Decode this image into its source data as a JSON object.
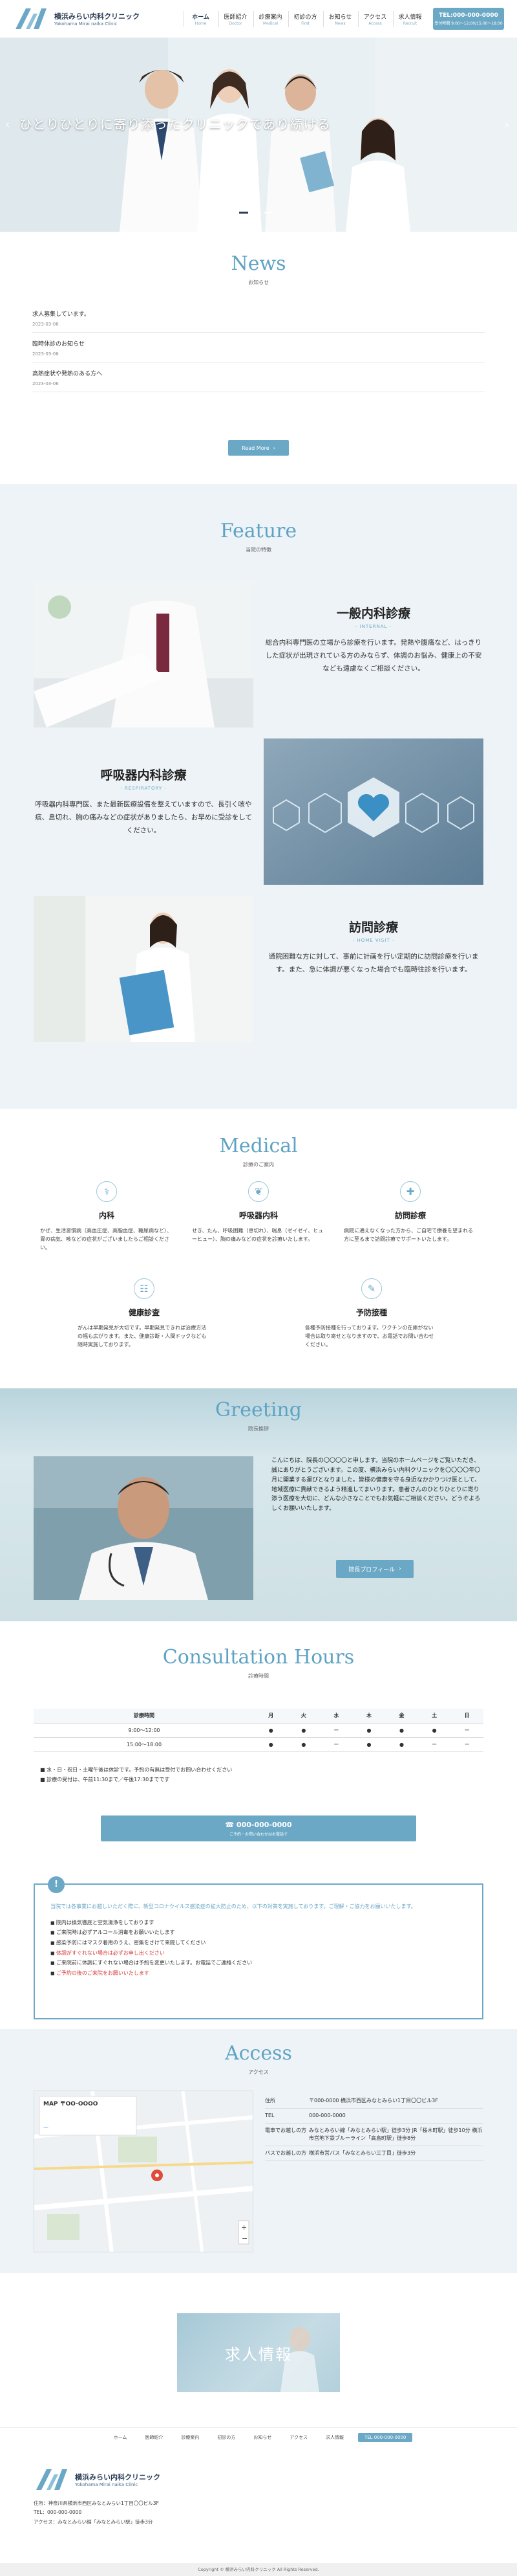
{
  "clinic": {
    "name_jp": "横浜みらい内科クリニック",
    "name_en": "Yokohama Mirai naika Clinic"
  },
  "nav": {
    "items": [
      {
        "jp": "ホーム",
        "en": "Home"
      },
      {
        "jp": "医師紹介",
        "en": "Doctor"
      },
      {
        "jp": "診療案内",
        "en": "Medical"
      },
      {
        "jp": "初診の方",
        "en": "First"
      },
      {
        "jp": "お知らせ",
        "en": "News"
      },
      {
        "jp": "アクセス",
        "en": "Access"
      },
      {
        "jp": "求人情報",
        "en": "Recruit"
      }
    ],
    "tel_number": "TEL:000-000-0000",
    "tel_sub": "受付時間 9:00〜12:00/15:00〜18:00"
  },
  "hero": {
    "copy": "ひとりひとりに寄り添ったクリニックであり続ける"
  },
  "news": {
    "title": "News",
    "subtitle": "お知らせ",
    "items": [
      {
        "text": "求人募集しています。",
        "date": "2023-03-06"
      },
      {
        "text": "臨時休診のお知らせ",
        "date": "2023-03-06"
      },
      {
        "text": "高熱症状や発熱のある方へ",
        "date": "2023-03-06"
      }
    ],
    "more_label": "Read More"
  },
  "feature": {
    "title": "Feature",
    "subtitle": "当院の特徴",
    "items": [
      {
        "title": "一般内科診療",
        "en": "- INTERNAL -",
        "text": "総合内科専門医の立場から診療を行います。発熱や腹痛など、はっきりした症状が出現されている方のみならず、体調のお悩み、健康上の不安なども遠慮なくご相談ください。"
      },
      {
        "title": "呼吸器内科診療",
        "en": "- RESPIRATORY -",
        "text": "呼吸器内科専門医、また最新医療設備を整えていますので、長引く咳や痰、息切れ、胸の痛みなどの症状がありましたら、お早めに受診をしてください。"
      },
      {
        "title": "訪問診療",
        "en": "- HOME VISIT -",
        "text": "通院困難な方に対して、事前に計画を行い定期的に訪問診療を行います。また、急に体調が悪くなった場合でも臨時往診を行います。"
      }
    ]
  },
  "medical": {
    "title": "Medical",
    "subtitle": "診療のご案内",
    "items": [
      {
        "icon": "stethoscope-icon",
        "glyph": "⚕",
        "title": "内科",
        "text": "かぜ、生活習慣病（高血圧症、高脂血症、糖尿病など）、胃の病気、咳などの症状がございましたらご相談ください。"
      },
      {
        "icon": "lungs-icon",
        "glyph": "❦",
        "title": "呼吸器内科",
        "text": "せき、たん、呼吸困難（息切れ）、喘息（ゼイゼイ、ヒューヒュー）、胸の痛みなどの症状を診療いたします。"
      },
      {
        "icon": "medical-bag-icon",
        "glyph": "✚",
        "title": "訪問診療",
        "text": "病院に通えなくなった方から、ご自宅で療養を望まれる方に至るまで訪問診療でサポートいたします。"
      },
      {
        "icon": "clipboard-icon",
        "glyph": "☷",
        "title": "健康診査",
        "text": "がんは早期発見が大切です。早期発見できれば治療方法の幅も広がります。また、健康診断・人間ドックなども随時実施しております。"
      },
      {
        "icon": "syringe-icon",
        "glyph": "✎",
        "title": "予防接種",
        "text": "各種予防接種を行っております。ワクチンの在庫がない場合は取り寄せとなりますので、お電話でお問い合わせください。"
      }
    ]
  },
  "greeting": {
    "title": "Greeting",
    "subtitle": "院長挨拶",
    "text": "こんにちは、院長の〇〇〇〇と申します。当院のホームページをご覧いただき、誠にありがとうございます。この度、横浜みらい内科クリニックを〇〇〇〇年〇月に開業する運びとなりました。皆様の健康を守る身近なかかりつけ医として、地域医療に貢献できるよう精進してまいります。患者さんのひとりひとりに寄り添う医療を大切に、どんな小さなことでもお気軽にご相談ください。どうぞよろしくお願いいたします。",
    "button_label": "院長プロフィール"
  },
  "hours": {
    "title": "Consultation Hours",
    "subtitle": "診療時間",
    "header": [
      "診療時間",
      "月",
      "火",
      "水",
      "木",
      "金",
      "土",
      "日"
    ],
    "rows": [
      [
        "9:00〜12:00",
        "●",
        "●",
        "ー",
        "●",
        "●",
        "●",
        "ー"
      ],
      [
        "15:00〜18:00",
        "●",
        "●",
        "ー",
        "●",
        "●",
        "ー",
        "ー"
      ]
    ],
    "notes": [
      "■ 水・日・祝日・土曜午後は休診です。予約の有無は受付でお問い合わせください",
      "■ 診療の受付は、午前11:30まで／午後17:30までです"
    ],
    "tel_number": "000-000-0000",
    "tel_sub": "ご予約・お問い合わせはお電話で"
  },
  "notice": {
    "badge": "!",
    "lead": "当院では各事業にお越しいただく際に、新型コロナウイルス感染症の拡大防止のため、以下の対策を実施しております。ご理解・ご協力をお願いいたします。",
    "items": [
      {
        "text": "院内は換気徹底と空気清浄をしております",
        "red": false
      },
      {
        "text": "ご来院時は必ずアルコール消毒をお願いいたします",
        "red": false
      },
      {
        "text": "感染予防にはマスク着用のうえ、密集をさけて来院してください",
        "red": false
      },
      {
        "text": "体調がすぐれない場合は必ずお申し出ください",
        "red": true
      },
      {
        "text": "ご来院前に体調にすぐれない場合は予約を変更いたします。お電話でご連絡ください",
        "red": false
      },
      {
        "text": "ご予約の後のご来院をお願いいたします",
        "red": true
      }
    ]
  },
  "access": {
    "title": "Access",
    "subtitle": "アクセス",
    "map_place": "MAP 〒OO-OOOO",
    "rows": [
      {
        "k": "住所",
        "v": "〒000-0000 横浜市西区みなとみらい1丁目〇〇ビル3F"
      },
      {
        "k": "TEL",
        "v": "000-000-0000"
      },
      {
        "k": "電車でお越しの方",
        "v": "みなとみらい線「みなとみらい駅」徒歩3分 JR「桜木町駅」徒歩10分 横浜市営地下鉄ブルーライン「高島町駅」徒歩8分"
      },
      {
        "k": "バスでお越しの方",
        "v": "横浜市営バス「みなとみらい三丁目」徒歩3分"
      }
    ]
  },
  "recruit": {
    "label": "求人情報"
  },
  "footer": {
    "nav": [
      "ホーム",
      "医師紹介",
      "診療案内",
      "初診の方",
      "お知らせ",
      "アクセス",
      "求人情報"
    ],
    "tel": "TEL 000-000-0000",
    "address": "住所：神奈川県横浜市西区みなとみらい1丁目〇〇ビル3F",
    "tel_line": "TEL：000-000-0000",
    "access_line": "アクセス：みなとみらい線「みなとみらい駅」徒歩3分",
    "copyright": "Copyright © 横浜みらい内科クリニック All Rights Reserved."
  },
  "colors": {
    "accent": "#6aa8c6",
    "title": "#5fa3c4",
    "navy": "#2a3b55"
  }
}
